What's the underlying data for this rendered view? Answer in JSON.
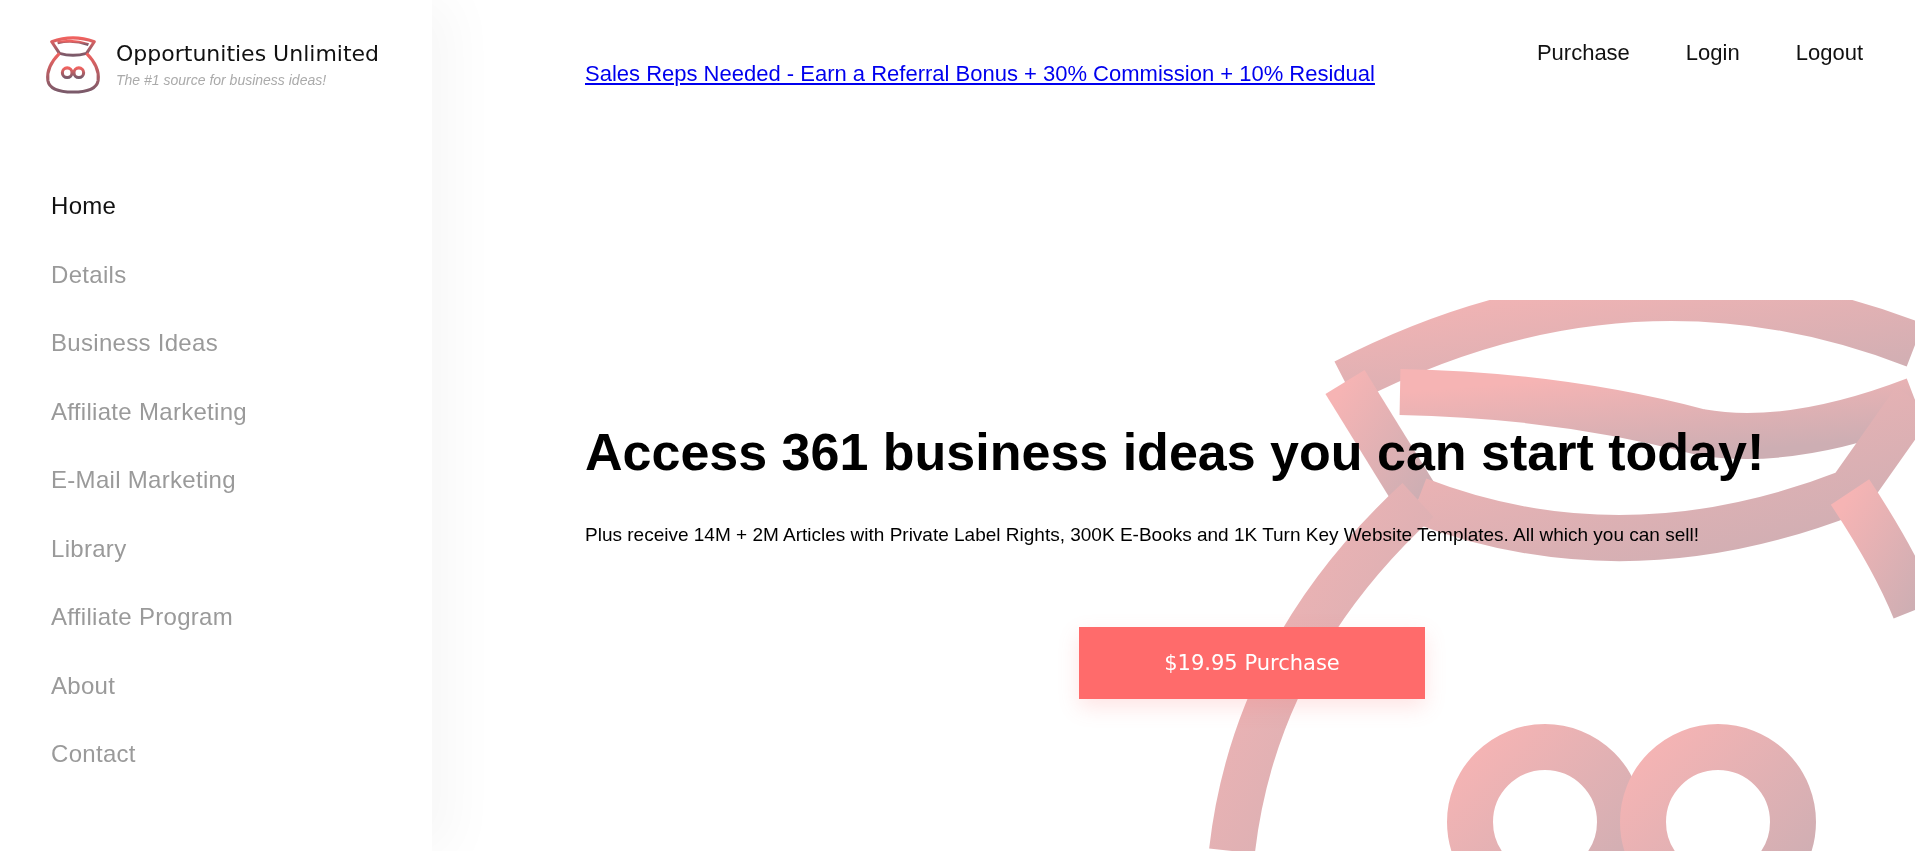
{
  "brand": {
    "name": "Opportunities Unlimited",
    "tagline": "The #1 source for business ideas!"
  },
  "sidebar": {
    "items": [
      {
        "label": "Home",
        "selected": true
      },
      {
        "label": "Details",
        "selected": false
      },
      {
        "label": "Business Ideas",
        "selected": false
      },
      {
        "label": "Affiliate Marketing",
        "selected": false
      },
      {
        "label": "E-Mail Marketing",
        "selected": false
      },
      {
        "label": "Library",
        "selected": false
      },
      {
        "label": "Affiliate Program",
        "selected": false
      },
      {
        "label": "About",
        "selected": false
      },
      {
        "label": "Contact",
        "selected": false
      }
    ]
  },
  "announcement_link": "Sales Reps Needed - Earn a Referral Bonus + 30% Commission + 10% Residual",
  "top_nav": [
    "Purchase",
    "Login",
    "Logout"
  ],
  "hero": {
    "heading": "Access 361 business ideas you can start today!",
    "subheading": "Plus receive 14M + 2M Articles with Private Label Rights, 300K E-Books and 1K Turn Key Website Templates. All which you can sell!",
    "button": "$19.95 Purchase"
  }
}
